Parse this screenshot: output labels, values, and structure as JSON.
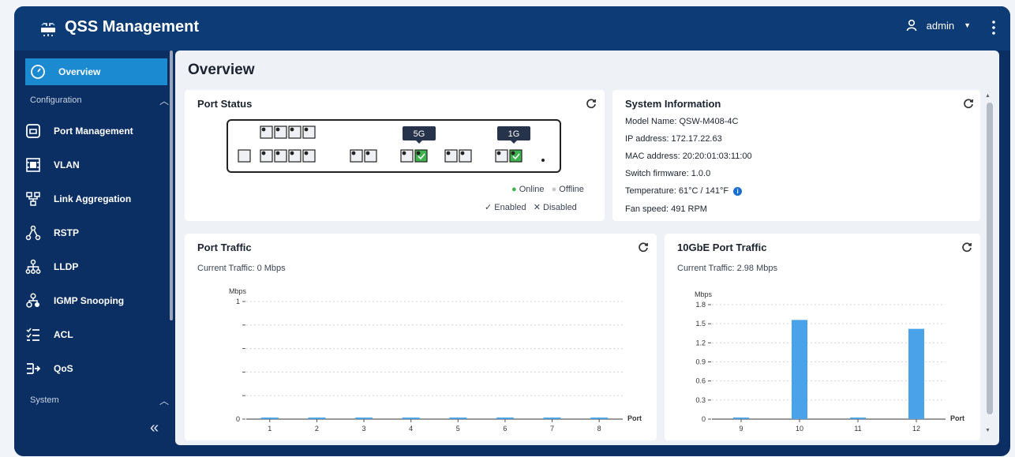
{
  "app": {
    "title": "QSS Management",
    "user": "admin"
  },
  "sidebar": {
    "overview": "Overview",
    "configuration_label": "Configuration",
    "system_label": "System",
    "items": [
      {
        "label": "Port Management",
        "icon": "port-icon"
      },
      {
        "label": "VLAN",
        "icon": "vlan-icon"
      },
      {
        "label": "Link Aggregation",
        "icon": "link-aggregation-icon"
      },
      {
        "label": "RSTP",
        "icon": "rstp-icon"
      },
      {
        "label": "LLDP",
        "icon": "lldp-icon"
      },
      {
        "label": "IGMP Snooping",
        "icon": "igmp-icon"
      },
      {
        "label": "ACL",
        "icon": "acl-icon"
      },
      {
        "label": "QoS",
        "icon": "qos-icon"
      }
    ]
  },
  "main": {
    "title": "Overview",
    "port_status": {
      "title": "Port Status",
      "badge_5g": "5G",
      "badge_1g": "1G",
      "legend_online": "Online",
      "legend_offline": "Offline",
      "legend_enabled": "Enabled",
      "legend_disabled": "Disabled"
    },
    "system_info": {
      "title": "System Information",
      "model": "Model Name:  QSW-M408-4C",
      "ip": "IP address:  172.17.22.63",
      "mac": "MAC address:  20:20:01:03:11:00",
      "firmware": "Switch firmware:  1.0.0",
      "temperature": "Temperature:  61°C / 141°F",
      "fan": "Fan speed:  491 RPM"
    },
    "port_traffic": {
      "title": "Port Traffic",
      "current": "Current Traffic:  0 Mbps"
    },
    "tengbe_traffic": {
      "title": "10GbE Port Traffic",
      "current": "Current Traffic:  2.98 Mbps"
    }
  },
  "colors": {
    "accent": "#1b8ad1",
    "online": "#3cb44b",
    "bar": "#4aa3e8",
    "header": "#0c3b76"
  },
  "chart_data": [
    {
      "type": "bar",
      "title": "Port Traffic",
      "ylabel": "Mbps",
      "xlabel": "Port",
      "categories": [
        "1",
        "2",
        "3",
        "4",
        "5",
        "6",
        "7",
        "8"
      ],
      "values": [
        0,
        0,
        0,
        0,
        0,
        0,
        0,
        0
      ],
      "yticks": [
        "1",
        "",
        "",
        "",
        "",
        "0"
      ],
      "ylim": [
        0,
        1
      ],
      "grid": true
    },
    {
      "type": "bar",
      "title": "10GbE Port Traffic",
      "ylabel": "Mbps",
      "xlabel": "Port",
      "categories": [
        "9",
        "10",
        "11",
        "12"
      ],
      "values": [
        0,
        1.56,
        0,
        1.42
      ],
      "yticks": [
        "1.8",
        "1.5",
        "1.2",
        "0.9",
        "0.6",
        "0.3",
        "0"
      ],
      "ylim": [
        0,
        1.8
      ],
      "grid": true
    }
  ]
}
